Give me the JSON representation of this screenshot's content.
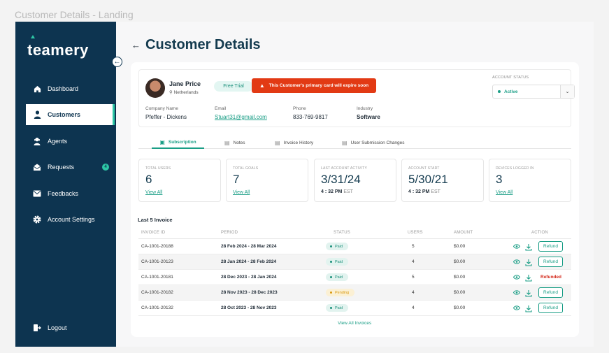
{
  "frame_title": "Customer Details - Landing",
  "brand": {
    "name": "teamery",
    "accent": "#2dc6a5",
    "sidebar_bg": "#0d3450"
  },
  "sidebar": {
    "items": [
      {
        "label": "Dashboard",
        "icon": "home-icon"
      },
      {
        "label": "Customers",
        "icon": "person-icon",
        "active": true
      },
      {
        "label": "Agents",
        "icon": "agent-icon"
      },
      {
        "label": "Requests",
        "icon": "mail-open-icon",
        "badge": "4"
      },
      {
        "label": "Feedbacks",
        "icon": "mail-icon"
      },
      {
        "label": "Account Settings",
        "icon": "gear-icon"
      }
    ],
    "logout": "Logout"
  },
  "header": {
    "title": "Customer Details"
  },
  "customer": {
    "name": "Jane Price",
    "location": "Netherlands",
    "plan_badge": "Free Trial",
    "warning": "This Customer's primary card will expire soon",
    "company_label": "Company Name",
    "company": "Pfeffer - Dickens",
    "email_label": "Email",
    "email": "Stuart31@gmail.com",
    "phone_label": "Phone",
    "phone": "833-769-9817",
    "industry_label": "Industry",
    "industry": "Software",
    "account_status_label": "ACCOUNT STATUS",
    "account_status": "Active"
  },
  "tabs": [
    {
      "label": "Subscription",
      "active": true
    },
    {
      "label": "Notes"
    },
    {
      "label": "Invoice History"
    },
    {
      "label": "User Submission Changes"
    }
  ],
  "stats": [
    {
      "label": "TOTAL USERS",
      "value": "6",
      "link": "View All"
    },
    {
      "label": "TOTAL GOALS",
      "value": "7",
      "link": "View All"
    },
    {
      "label": "LAST ACCOUNT ACTIVITY",
      "value": "3/31/24",
      "time": "4 : 32 PM",
      "tz": "EST"
    },
    {
      "label": "ACCOUNT START",
      "value": "5/30/21",
      "time": "4 : 32 PM",
      "tz": "EST"
    },
    {
      "label": "DEVICES LOGGED IN",
      "value": "3",
      "link": "View All"
    }
  ],
  "invoices": {
    "title": "Last 5 Invoice",
    "columns": [
      "INVOICE ID",
      "PERIOD",
      "STATUS",
      "USERS",
      "AMOUNT",
      "ACTION"
    ],
    "rows": [
      {
        "id": "CA-1001-20188",
        "period": "28 Feb 2024 - 28 Mar 2024",
        "status": "Paid",
        "users": "5",
        "amount": "$0.00",
        "action": "Refund"
      },
      {
        "id": "CA-1001-20123",
        "period": "28 Jan 2024 - 28 Feb 2024",
        "status": "Paid",
        "users": "4",
        "amount": "$0.00",
        "action": "Refund"
      },
      {
        "id": "CA-1001-20181",
        "period": "28 Dec 2023 - 28 Jan 2024",
        "status": "Paid",
        "users": "5",
        "amount": "$0.00",
        "action": "Refunded"
      },
      {
        "id": "CA-1001-20182",
        "period": "28 Nov 2023 - 28 Dec 2023",
        "status": "Pending",
        "users": "4",
        "amount": "$0.00",
        "action": "Refund"
      },
      {
        "id": "CA-1001-20132",
        "period": "28 Oct 2023 - 28 Nov 2023",
        "status": "Paid",
        "users": "4",
        "amount": "$0.00",
        "action": "Refund"
      }
    ],
    "view_all": "View All Invoices"
  }
}
